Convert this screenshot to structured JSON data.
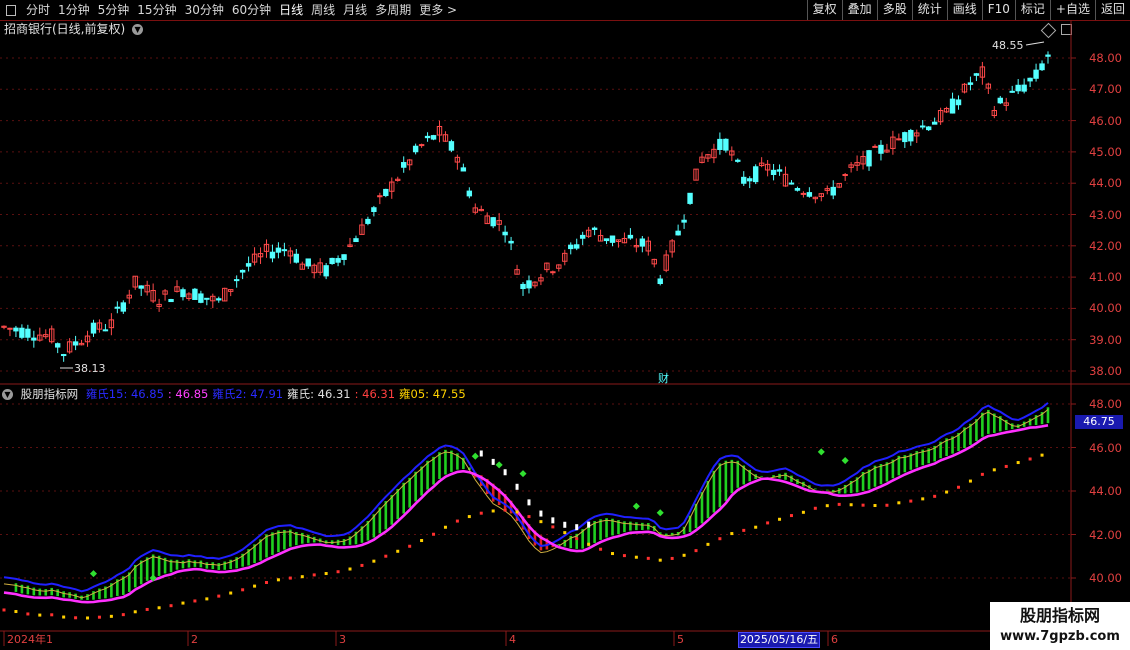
{
  "toolbar": {
    "left_items": [
      "分时",
      "1分钟",
      "5分钟",
      "15分钟",
      "30分钟",
      "60分钟",
      "日线",
      "周线",
      "月线",
      "多周期",
      "更多 >"
    ],
    "active": "日线",
    "right_items": [
      "复权",
      "叠加",
      "多股",
      "统计",
      "画线",
      "F10",
      "标记",
      "+自选",
      "返回"
    ]
  },
  "chart": {
    "title": "招商银行(日线,前复权)",
    "price_axis": [
      "48.00",
      "47.00",
      "46.00",
      "45.00",
      "44.00",
      "43.00",
      "42.00",
      "41.00",
      "40.00",
      "39.00",
      "38.00"
    ],
    "high_label": "48.55",
    "low_label": "38.13",
    "event_marker": "财",
    "up_color": "#ff4a4a",
    "down_color": "#54ffff"
  },
  "indicator": {
    "name": "股朋指标网",
    "legend": [
      {
        "text": "雍氏15: 46.85",
        "color": "#2a2aff"
      },
      {
        "text": ": 46.85",
        "color": "#ff40ff"
      },
      {
        "text": "雍氏2: 47.91",
        "color": "#2a2aff"
      },
      {
        "text": "雍氏: 46.31",
        "color": "#e0e0e0"
      },
      {
        "text": ": 46.31",
        "color": "#ff4040"
      },
      {
        "text": "雍05: 47.55",
        "color": "#ffd200"
      }
    ],
    "axis": [
      "48.00",
      "46.00",
      "44.00",
      "42.00",
      "40.00"
    ],
    "current_value": "46.75"
  },
  "time_axis": {
    "labels": [
      "2024年1",
      "2",
      "3",
      "4",
      "5",
      "6"
    ],
    "cursor_date": "2025/05/16/五"
  },
  "watermark": {
    "line1": "股朋指标网",
    "line2": "www.7gpzb.com"
  }
}
